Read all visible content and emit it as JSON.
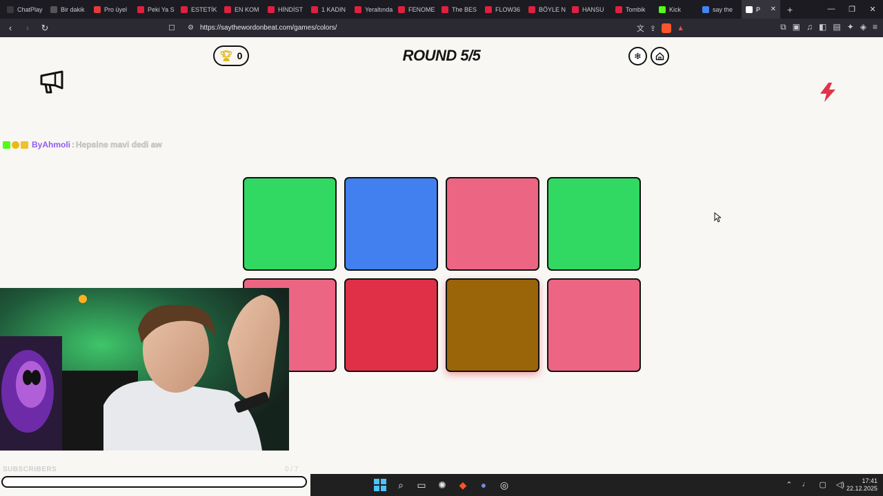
{
  "browser": {
    "tabs": [
      {
        "label": "ChatPlay",
        "color": "#3a3a3a"
      },
      {
        "label": "Bir dakik",
        "color": "#555555"
      },
      {
        "label": "Pro üyel",
        "color": "#e33b3b"
      },
      {
        "label": "Peki Ya S",
        "color": "#e02040"
      },
      {
        "label": "ESTETİK",
        "color": "#e02040"
      },
      {
        "label": "EN KOM",
        "color": "#e02040"
      },
      {
        "label": "HİNDİST",
        "color": "#e02040"
      },
      {
        "label": "1 KADIN",
        "color": "#e02040"
      },
      {
        "label": "Yeraltında",
        "color": "#e02040"
      },
      {
        "label": "FENOME",
        "color": "#e02040"
      },
      {
        "label": "The BES",
        "color": "#e02040"
      },
      {
        "label": "FLOW36",
        "color": "#e02040"
      },
      {
        "label": "BÖYLE N",
        "color": "#e02040"
      },
      {
        "label": "HANSU",
        "color": "#e02040"
      },
      {
        "label": "Tombik",
        "color": "#e02040"
      },
      {
        "label": "Kick",
        "color": "#53fc18"
      },
      {
        "label": "say the",
        "color": "#4285f4"
      }
    ],
    "active_tab_label": "P",
    "url": "https://saythewordonbeat.com/games/colors/"
  },
  "game": {
    "score": "0",
    "round_label": "ROUND 5/5",
    "tiles": [
      {
        "color": "#31d862",
        "highlight": false
      },
      {
        "color": "#4180ee",
        "highlight": false
      },
      {
        "color": "#ec6582",
        "highlight": false
      },
      {
        "color": "#31d862",
        "highlight": false
      },
      {
        "color": "#ec6582",
        "highlight": false
      },
      {
        "color": "#e03048",
        "highlight": false
      },
      {
        "color": "#9a6409",
        "highlight": true
      },
      {
        "color": "#ec6582",
        "highlight": false
      }
    ]
  },
  "chat": {
    "username": "ByAhmoli",
    "separator": ":",
    "message": "Hepsine mavi dedi aw"
  },
  "stream_overlay": {
    "subscribers_label": "SUBSCRIBERS",
    "sub_count": "0 / 7"
  },
  "taskbar": {
    "time": "17:41",
    "date": "22.12.2025"
  },
  "icons": {
    "score": "trophy-icon",
    "settings": "snowflake-icon",
    "home": "home-icon",
    "announce": "megaphone-icon",
    "bolt": "lightning-icon"
  }
}
